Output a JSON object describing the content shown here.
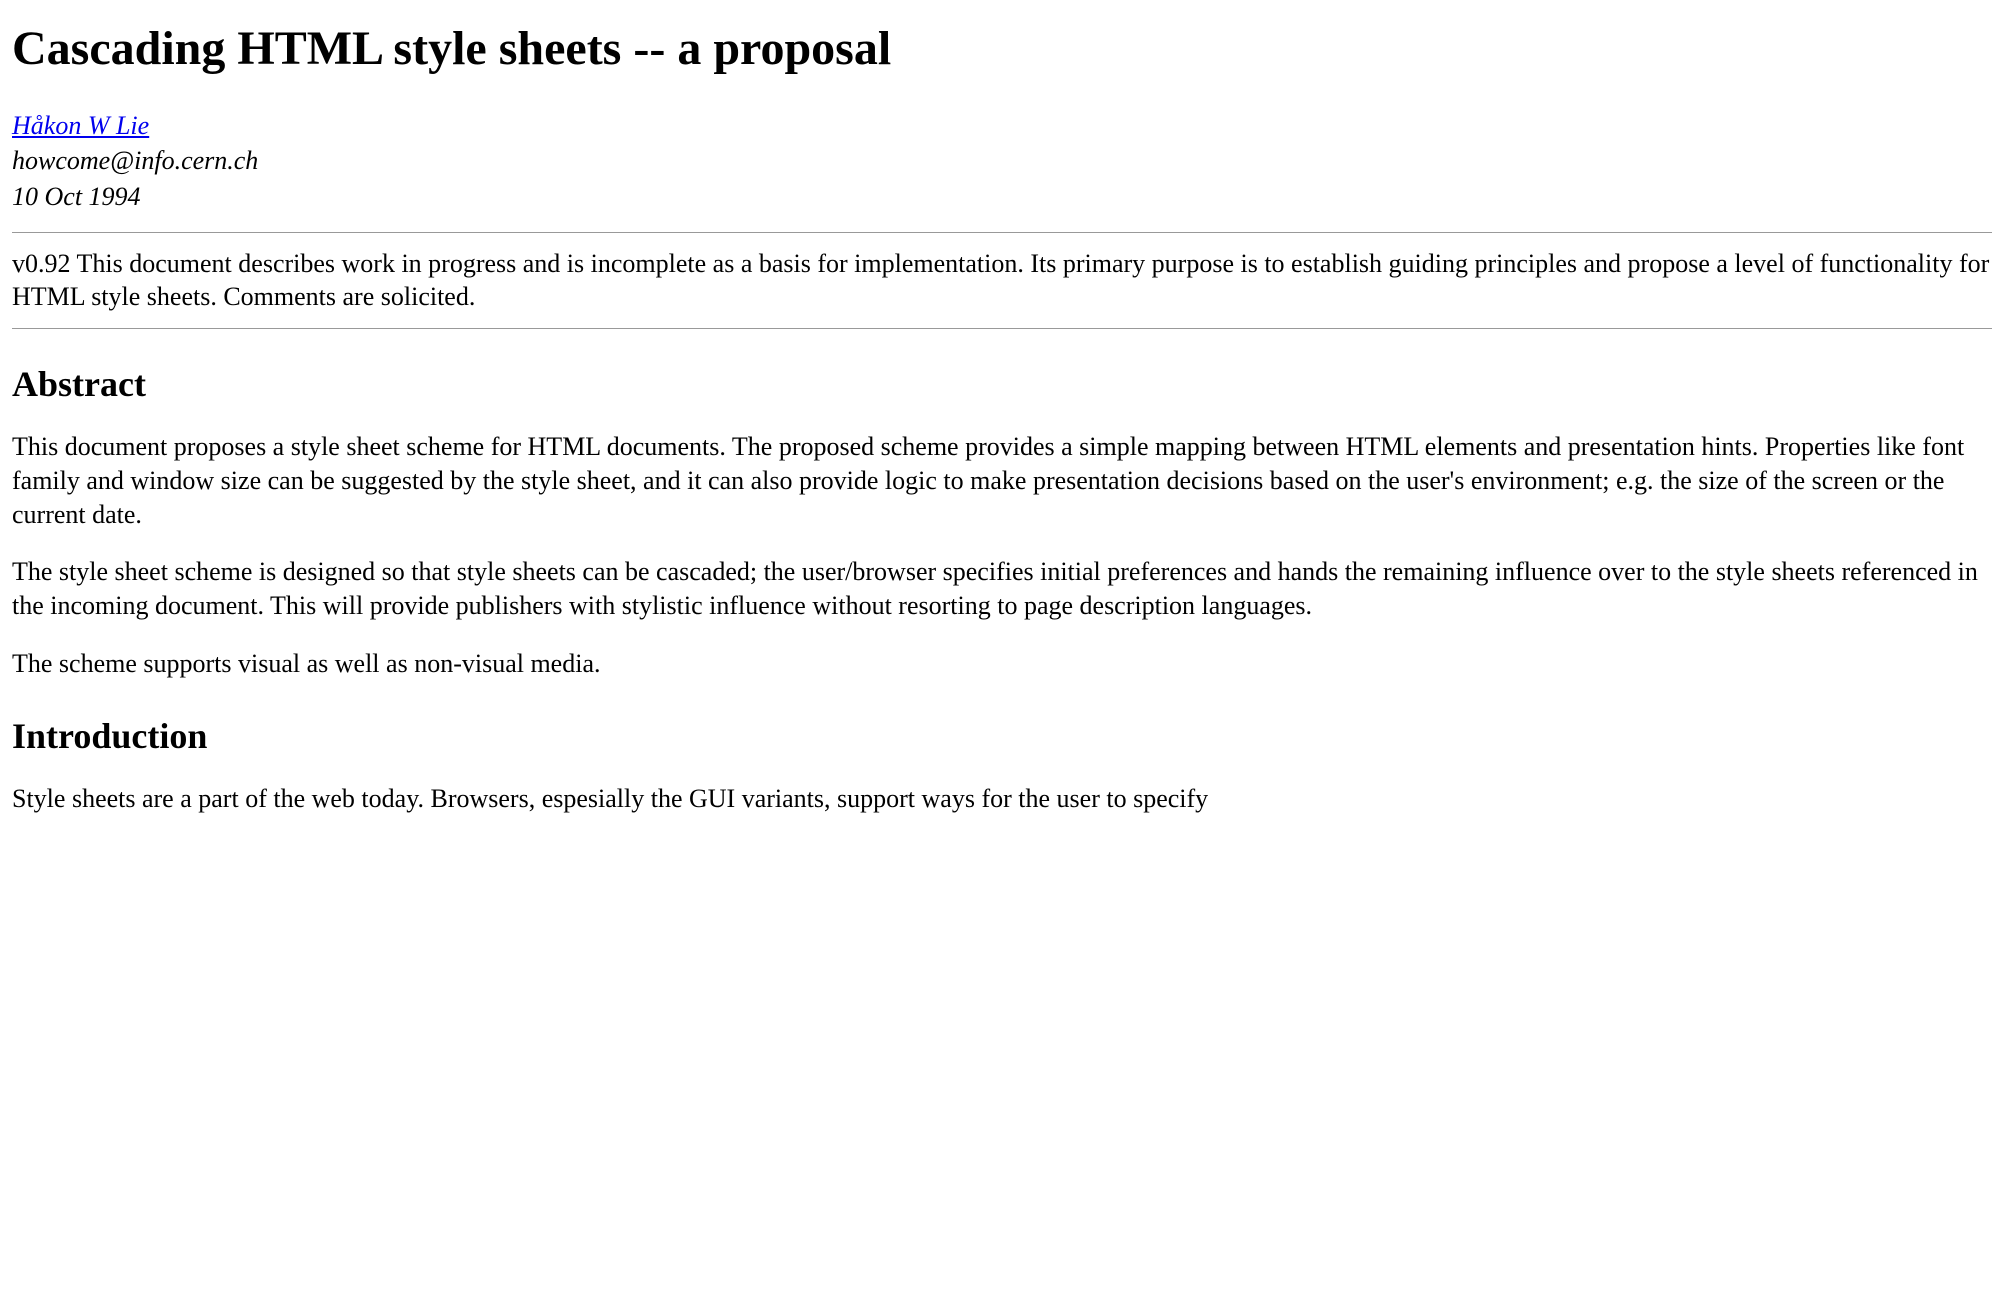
{
  "title": "Cascading HTML style sheets -- a proposal",
  "author": {
    "name": "Håkon W Lie",
    "email": "howcome@info.cern.ch",
    "date": "10 Oct 1994"
  },
  "version_note": "v0.92 This document describes work in progress and is incomplete as a basis for implementation. Its primary purpose is to establish guiding principles and propose a level of functionality for HTML style sheets. Comments are solicited.",
  "sections": {
    "abstract": {
      "heading": "Abstract",
      "paragraphs": [
        "This document proposes a style sheet scheme for HTML documents. The proposed scheme provides a simple mapping between HTML elements and presentation hints. Properties like font family and window size can be suggested by the style sheet, and it can also provide logic to make presentation decisions based on the user's environment; e.g. the size of the screen or the current date.",
        "The style sheet scheme is designed so that style sheets can be cascaded; the user/browser specifies initial preferences and hands the remaining influence over to the style sheets referenced in the incoming document. This will provide publishers with stylistic influence without resorting to page description languages.",
        "The scheme supports visual as well as non-visual media."
      ]
    },
    "introduction": {
      "heading": "Introduction",
      "paragraphs": [
        "Style sheets are a part of the web today. Browsers, espesially the GUI variants, support ways for the user to specify"
      ]
    }
  }
}
